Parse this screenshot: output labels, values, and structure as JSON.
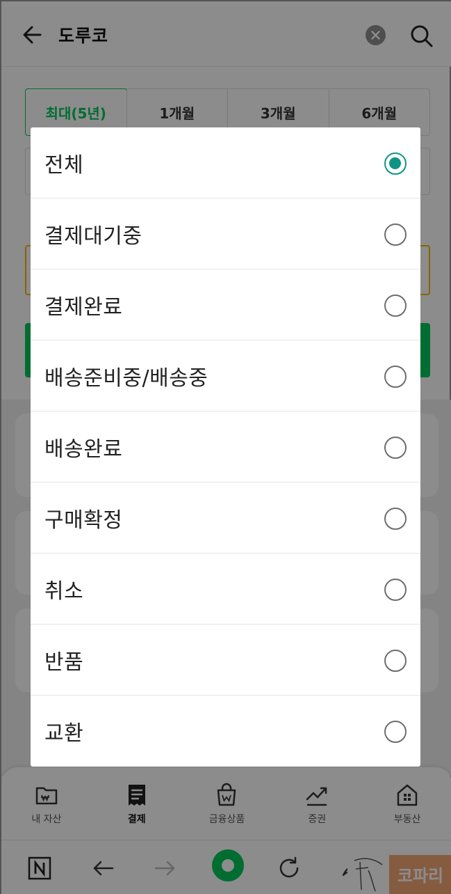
{
  "header": {
    "title": "도루코"
  },
  "period_tabs": [
    {
      "label": "최대(5년)",
      "active": true
    },
    {
      "label": "1개월",
      "active": false
    },
    {
      "label": "3개월",
      "active": false
    },
    {
      "label": "6개월",
      "active": false
    }
  ],
  "bottom_tabs": [
    {
      "label": "내 자산",
      "icon": "wallet-icon",
      "active": false
    },
    {
      "label": "결제",
      "icon": "receipt-icon",
      "active": true
    },
    {
      "label": "금융상품",
      "icon": "shopping-bag-icon",
      "active": false
    },
    {
      "label": "증권",
      "icon": "chart-up-icon",
      "active": false
    },
    {
      "label": "부동산",
      "icon": "house-icon",
      "active": false
    }
  ],
  "browser_bar": {
    "icons": [
      "naver-n-icon",
      "back-arrow-icon",
      "forward-arrow-icon",
      "home-icon",
      "refresh-icon",
      "share-icon",
      "menu-icon"
    ]
  },
  "watermark": {
    "text": "코파리"
  },
  "status_filter": {
    "selected": "전체",
    "options": [
      {
        "label": "전체",
        "checked": true
      },
      {
        "label": "결제대기중",
        "checked": false
      },
      {
        "label": "결제완료",
        "checked": false
      },
      {
        "label": "배송준비중/배송중",
        "checked": false
      },
      {
        "label": "배송완료",
        "checked": false
      },
      {
        "label": "구매확정",
        "checked": false
      },
      {
        "label": "취소",
        "checked": false
      },
      {
        "label": "반품",
        "checked": false
      },
      {
        "label": "교환",
        "checked": false
      }
    ]
  },
  "colors": {
    "accent": "#03c75a",
    "radio_checked": "#0f9483",
    "overlay": "rgba(0,0,0,0.45)"
  }
}
